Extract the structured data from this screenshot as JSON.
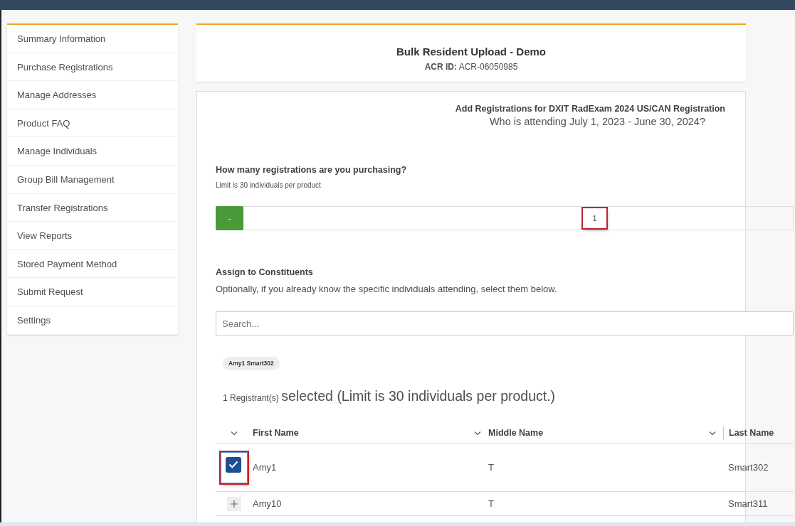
{
  "sidebar": {
    "items": [
      {
        "label": "Summary Information"
      },
      {
        "label": "Purchase Registrations"
      },
      {
        "label": "Manage Addresses"
      },
      {
        "label": "Product FAQ"
      },
      {
        "label": "Manage Individuals"
      },
      {
        "label": "Group Bill Management"
      },
      {
        "label": "Transfer Registrations"
      },
      {
        "label": "View Reports"
      },
      {
        "label": "Stored Payment Method"
      },
      {
        "label": "Submit Request"
      },
      {
        "label": "Settings"
      }
    ]
  },
  "header": {
    "title": "Bulk Resident Upload - Demo",
    "id_label": "ACR ID:",
    "id_value": "ACR-06050985"
  },
  "form": {
    "product_title": "Add Registrations for DXIT RadExam 2024 US/CAN Registration",
    "question": "Who is attending July 1, 2023 - June 30, 2024?",
    "quantity": {
      "label": "How many registrations are you purchasing?",
      "hint": "Limit is 30 individuals per product",
      "decrement": "-",
      "value": "1",
      "highlighted": true
    },
    "assign": {
      "label": "Assign to Constituents",
      "description": "Optionally, if you already know the specific individuals attending, select them below.",
      "search": {
        "placeholder": "Search..."
      }
    },
    "chips": [
      "Amy1 Smart302"
    ],
    "selection": {
      "count": "1 Registrant(s)",
      "text": "selected (Limit is 30 individuals per product.)"
    },
    "table": {
      "columns": [
        "First Name",
        "Middle Name",
        "Last Name"
      ],
      "rows": [
        {
          "selected": true,
          "highlighted": true,
          "cells": [
            "Amy1",
            "T",
            "Smart302"
          ]
        },
        {
          "selected": false,
          "highlighted": false,
          "cells": [
            "Amy10",
            "T",
            "Smart311"
          ]
        }
      ]
    }
  }
}
